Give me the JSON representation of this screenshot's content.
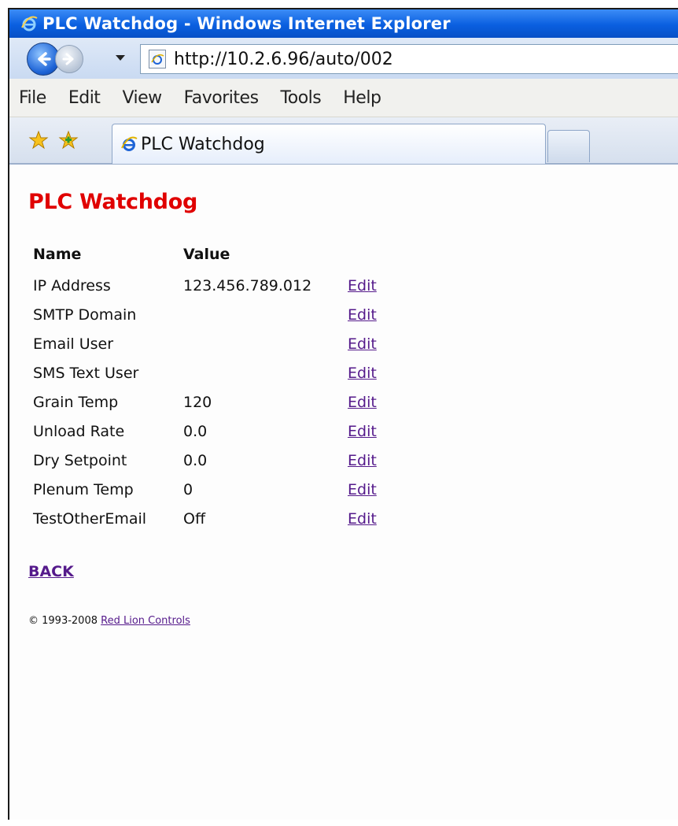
{
  "window": {
    "title": "PLC Watchdog - Windows Internet Explorer"
  },
  "address_bar": {
    "url": "http://10.2.6.96/auto/002"
  },
  "menu": [
    "File",
    "Edit",
    "View",
    "Favorites",
    "Tools",
    "Help"
  ],
  "tab": {
    "title": "PLC Watchdog"
  },
  "page": {
    "heading": "PLC Watchdog",
    "table": {
      "headers": {
        "name": "Name",
        "value": "Value"
      },
      "rows": [
        {
          "name": "IP Address",
          "value": "123.456.789.012",
          "action": "Edit"
        },
        {
          "name": "SMTP Domain",
          "value": "",
          "action": "Edit"
        },
        {
          "name": "Email User",
          "value": "",
          "action": "Edit"
        },
        {
          "name": "SMS Text User",
          "value": "",
          "action": "Edit"
        },
        {
          "name": "Grain Temp",
          "value": "120",
          "action": "Edit"
        },
        {
          "name": "Unload Rate",
          "value": "0.0",
          "action": "Edit"
        },
        {
          "name": "Dry Setpoint",
          "value": "0.0",
          "action": "Edit"
        },
        {
          "name": "Plenum Temp",
          "value": "0",
          "action": "Edit"
        },
        {
          "name": "TestOtherEmail",
          "value": "Off",
          "action": "Edit"
        }
      ]
    },
    "back_label": "BACK",
    "footer": {
      "copyright": "© 1993-2008",
      "company_link": "Red Lion Controls"
    }
  },
  "colors": {
    "heading": "#e00000",
    "link": "#551a8b",
    "titlebar": "#0a5fe0"
  },
  "icons": [
    "ie-logo-icon",
    "back-arrow-icon",
    "forward-arrow-icon",
    "chevron-down-icon",
    "page-icon",
    "favorites-star-icon",
    "add-favorites-icon"
  ]
}
